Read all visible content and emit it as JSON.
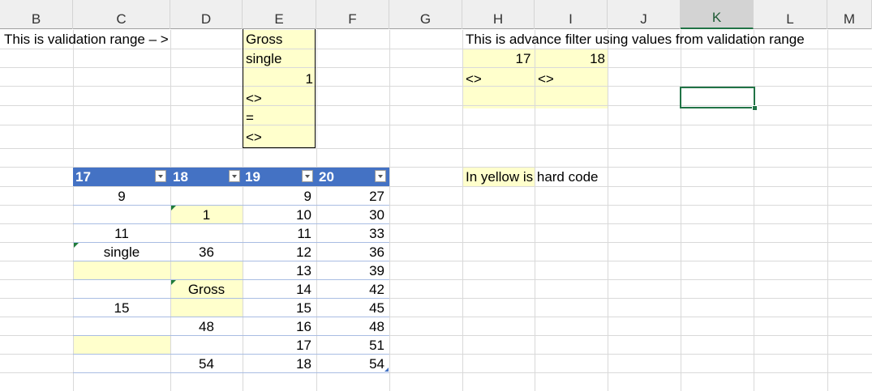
{
  "columns": [
    "B",
    "C",
    "D",
    "E",
    "F",
    "G",
    "H",
    "I",
    "J",
    "K",
    "L",
    "M"
  ],
  "active_column": "K",
  "labels": {
    "validation": "This is validation range – >",
    "advance_filter": "This is advance filter using values from validation range",
    "yellow_hard_code": "In yellow is hard code",
    "yellow_word": "In yellow is"
  },
  "validation_range": [
    "Gross",
    "single",
    "1",
    "<>",
    "=",
    "<>"
  ],
  "filter": {
    "h1": "17",
    "i1": "18",
    "h2": "<>",
    "i2": "<>"
  },
  "table": {
    "headers": [
      "17",
      "18",
      "19",
      "20"
    ],
    "rows": [
      [
        "9",
        "",
        "9",
        "27"
      ],
      [
        "",
        "1",
        "10",
        "30"
      ],
      [
        "11",
        "",
        "11",
        "33"
      ],
      [
        "single",
        "36",
        "12",
        "36"
      ],
      [
        "",
        "",
        "13",
        "39"
      ],
      [
        "",
        "Gross",
        "14",
        "42"
      ],
      [
        "15",
        "",
        "15",
        "45"
      ],
      [
        "",
        "48",
        "16",
        "48"
      ],
      [
        "",
        "",
        "17",
        "51"
      ],
      [
        "",
        "54",
        "18",
        "54"
      ]
    ]
  },
  "colors": {
    "table_header": "#4472c4",
    "hard_code_fill": "#ffffcc",
    "selection": "#217346"
  }
}
